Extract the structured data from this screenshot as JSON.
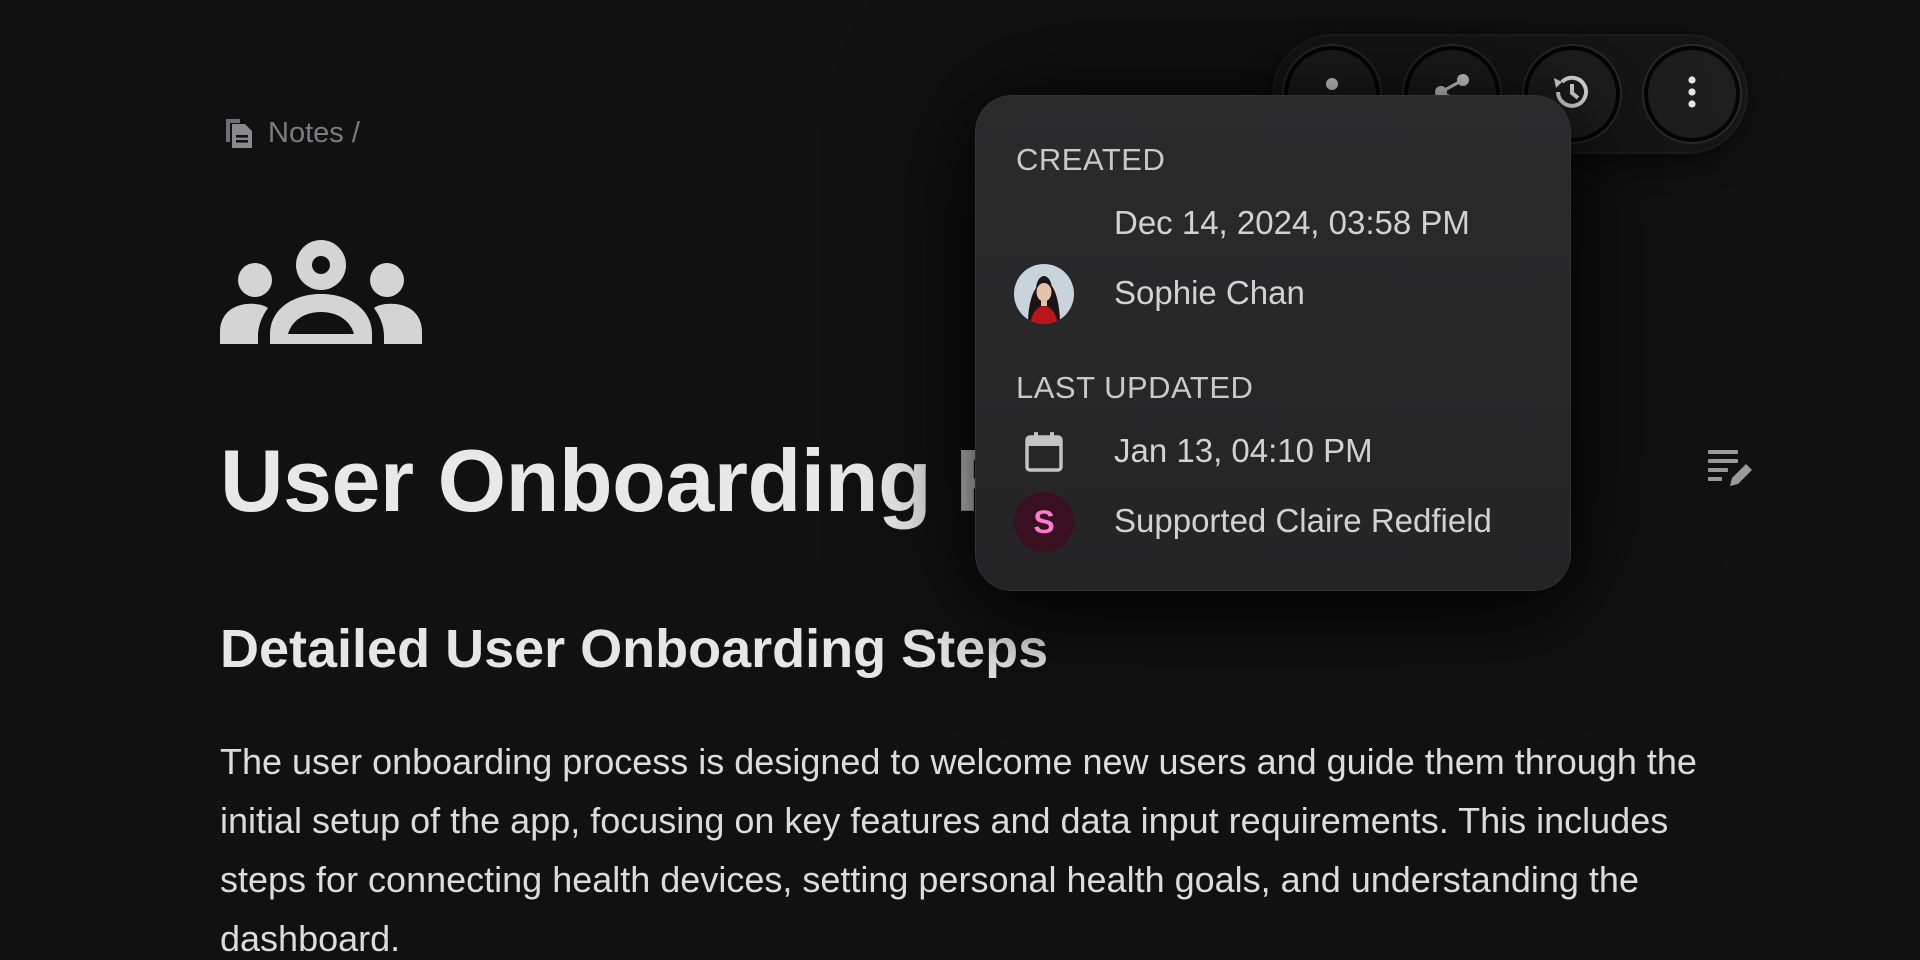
{
  "breadcrumb": {
    "icon": "notes-icon",
    "label": "Notes /"
  },
  "page": {
    "icon": "group-icon",
    "title": "User Onboarding F",
    "edit_icon": "edit-notes-icon"
  },
  "content": {
    "heading": "Detailed User Onboarding Steps",
    "paragraph": "The user onboarding process is designed to welcome new users and guide them through the initial setup of the app, focusing on key features and data input requirements. This includes steps for connecting health devices, setting personal health goals, and understanding the dashboard."
  },
  "toolbar": {
    "buttons": [
      "person-icon",
      "share-icon",
      "history-icon",
      "more-vertical-icon"
    ]
  },
  "info_popover": {
    "created_label": "CREATED",
    "created_date": "Dec 14, 2024, 03:58 PM",
    "created_by": "Sophie Chan",
    "updated_label": "LAST UPDATED",
    "updated_date": "Jan 13, 04:10 PM",
    "updated_by": "Supported Claire Redfield",
    "updated_by_initial": "S"
  },
  "colors": {
    "background": "#111112",
    "popover": "#2b2b2c",
    "avatar_initial_bg": "#3a1020",
    "avatar_initial_fg": "#ff7ad0"
  }
}
